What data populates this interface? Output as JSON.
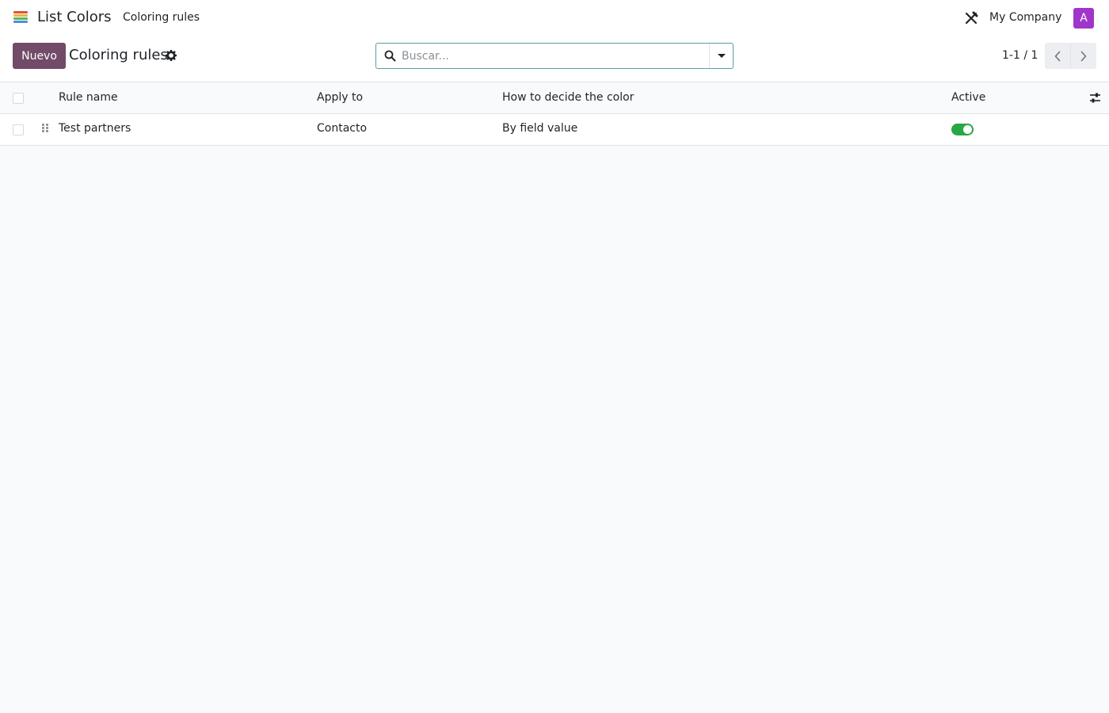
{
  "navbar": {
    "app_name": "List Colors",
    "menu_item": "Coloring rules",
    "company": "My Company",
    "avatar_letter": "A",
    "app_icon_colors": [
      "#e0513e",
      "#f2b33d",
      "#5cb85c",
      "#4a90d9",
      "#9b59b6"
    ]
  },
  "control": {
    "new_button": "Nuevo",
    "title": "Coloring rules",
    "search_placeholder": "Buscar...",
    "pager": "1-1 / 1"
  },
  "list": {
    "columns": [
      "Rule name",
      "Apply to",
      "How to decide the color",
      "Active"
    ],
    "rows": [
      {
        "name": "Test partners",
        "apply_to": "Contacto",
        "how": "By field value",
        "active": true
      }
    ]
  },
  "colors": {
    "primary": "#714b67",
    "toggle_on": "#28a745",
    "avatar": "#a036c9"
  },
  "icons": [
    "app-icon",
    "debug-tools-icon",
    "gear-icon",
    "search-icon",
    "caret-down-icon",
    "chevron-left-icon",
    "chevron-right-icon",
    "optional-columns-icon",
    "drag-handle-icon"
  ]
}
